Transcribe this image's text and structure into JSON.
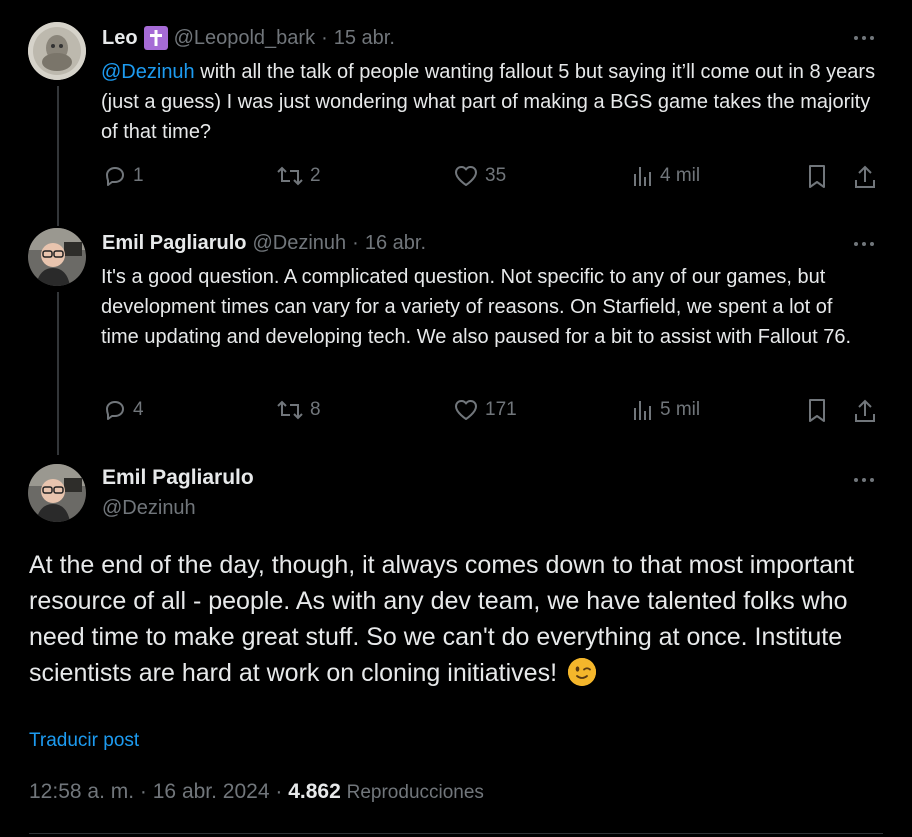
{
  "tweets": [
    {
      "name": "Leo",
      "badge_icon": "latin-cross-icon",
      "handle": "@Leopold_bark",
      "separator": "·",
      "date": "15 abr.",
      "mention": "@Dezinuh",
      "text_after_mention": " with all the talk of people wanting fallout 5 but saying it’ll come out in 8 years (just a guess) I was just wondering what part of making a BGS game takes the majority of that time?",
      "stats": {
        "replies": "1",
        "reposts": "2",
        "likes": "35",
        "views": "4 mil"
      }
    },
    {
      "name": "Emil Pagliarulo",
      "handle": "@Dezinuh",
      "separator": "·",
      "date": "16 abr.",
      "text": "It's a good question. A complicated question. Not specific to any of our games, but development times can vary for a variety of reasons. On Starfield, we spent a lot of time updating and developing tech. We also paused for a bit to assist with Fallout 76.",
      "stats": {
        "replies": "4",
        "reposts": "8",
        "likes": "171",
        "views": "5 mil"
      }
    }
  ],
  "main_tweet": {
    "name": "Emil Pagliarulo",
    "handle": "@Dezinuh",
    "text": "At the end of the day, though, it always comes down to that most important resource of all - people. As with any dev team, we have talented folks who need time to make great stuff. So we can't do everything at once. Institute scientists are hard at work on cloning initiatives!",
    "emoji": "winking-face",
    "translate": "Traducir post",
    "time": "12:58 a. m.",
    "sep": "·",
    "date": "16 abr. 2024",
    "views_count": "4.862",
    "views_label": "Reproducciones"
  },
  "colors": {
    "background": "#000000",
    "text": "#e7e9ea",
    "muted": "#71767b",
    "accent": "#1d9bf0",
    "badge": "#a66bd6"
  }
}
